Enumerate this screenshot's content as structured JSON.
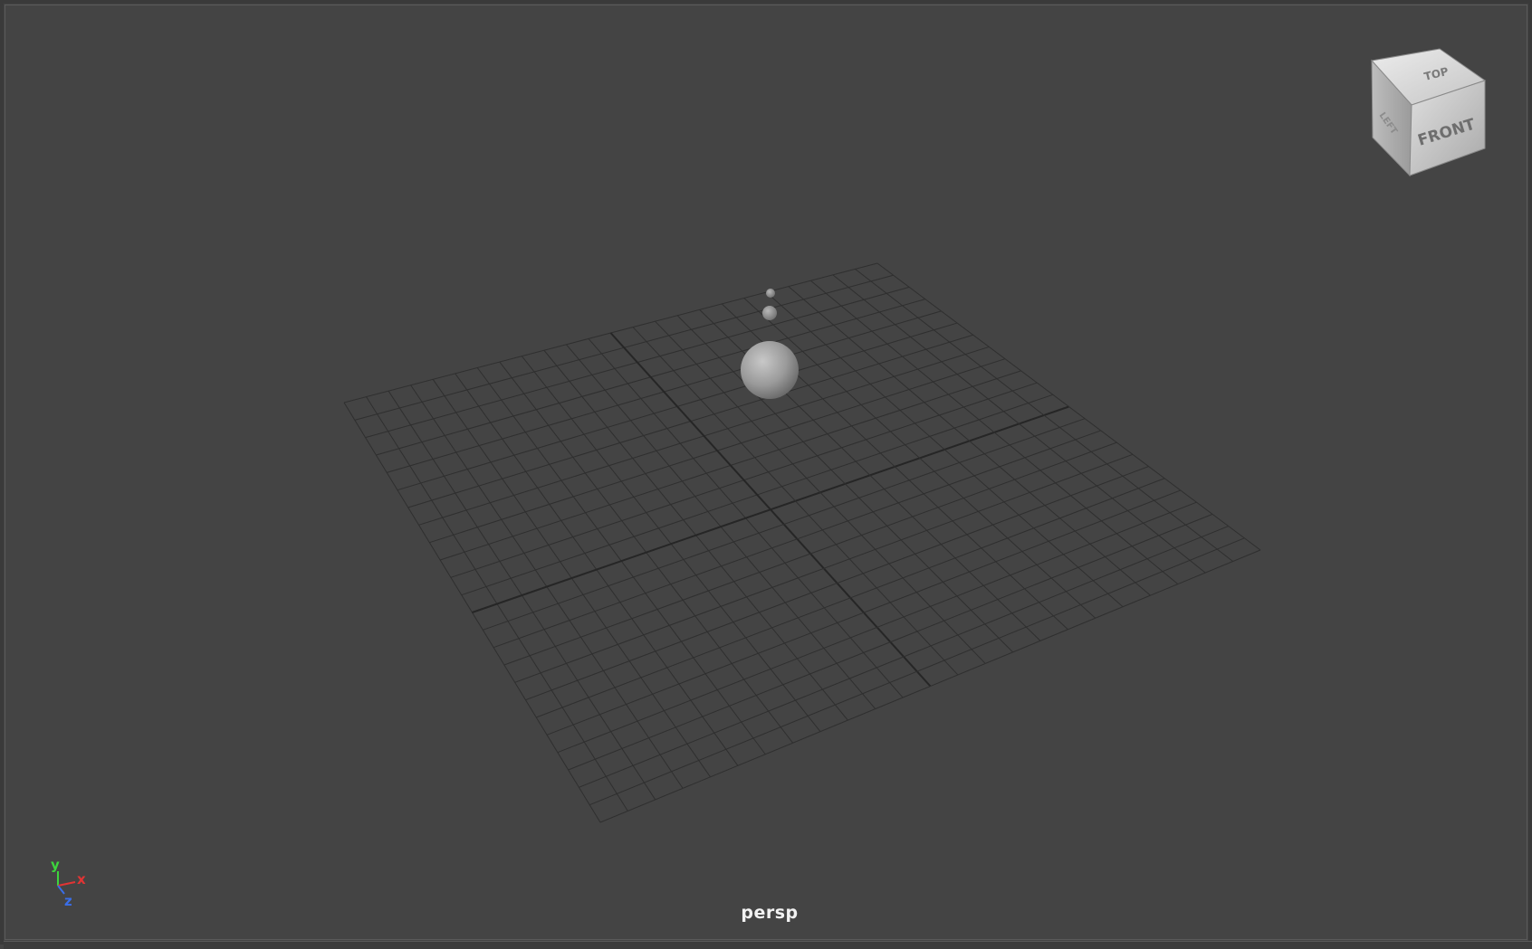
{
  "viewport": {
    "camera_name": "persp"
  },
  "view_cube": {
    "top_label": "TOP",
    "front_label": "FRONT",
    "left_label": "LEFT"
  },
  "axis_gizmo": {
    "y_label": "y",
    "x_label": "x",
    "z_label": "z",
    "y_color": "#3dd43d",
    "x_color": "#e23434",
    "z_color": "#3a6ee8"
  },
  "colors": {
    "background": "#444444",
    "grid_line": "#2f2f2f",
    "grid_axis": "#262626",
    "sphere": "#9a9a9a"
  },
  "scene_objects": {
    "spheres": 3
  }
}
